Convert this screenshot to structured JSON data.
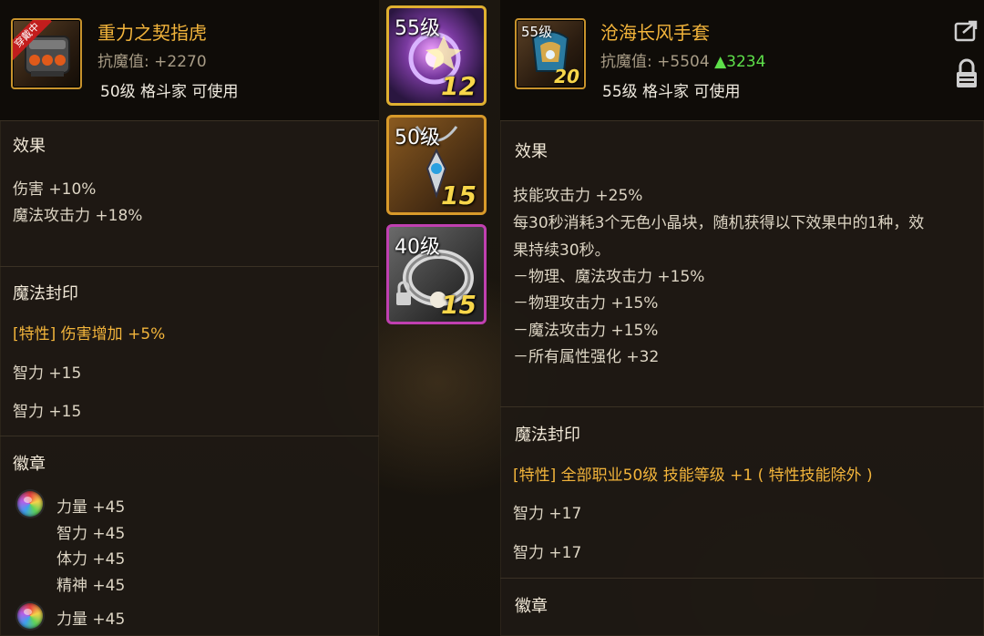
{
  "left_item": {
    "badge": "穿戴中",
    "name": "重力之契指虎",
    "resist_label": "抗魔值: ",
    "resist_value": "+2270",
    "requirement": "50级 格斗家 可使用",
    "effects_title": "效果",
    "effects": [
      "伤害 +10%",
      "魔法攻击力 +18%"
    ],
    "seal_title": "魔法封印",
    "seal_trait": "[特性] 伤害增加 +5%",
    "seal_lines": [
      "智力 +15",
      "智力 +15"
    ],
    "emblem_title": "徽章",
    "emblem_group1": [
      "力量 +45",
      "智力 +45",
      "体力 +45",
      "精神 +45"
    ],
    "emblem_group2": [
      "力量 +45"
    ]
  },
  "compare_thumbs": [
    {
      "level": "55级",
      "count": "12",
      "border": "#e0b030"
    },
    {
      "level": "50级",
      "count": "15",
      "border": "#d89a2a"
    },
    {
      "level": "40级",
      "count": "15",
      "border": "#c040b0"
    }
  ],
  "right_item": {
    "level_badge": "55级",
    "count_badge": "20",
    "name": "沧海长风手套",
    "resist_label": "抗魔值: ",
    "resist_value": "+5504",
    "resist_diff": "▲3234",
    "requirement": "55级 格斗家 可使用",
    "effects_title": "效果",
    "effects": [
      "技能攻击力 +25%",
      "每30秒消耗3个无色小晶块，随机获得以下效果中的1种，效",
      "果持续30秒。",
      "－物理、魔法攻击力 +15%",
      "－物理攻击力 +15%",
      "－魔法攻击力 +15%",
      "－所有属性强化 +32"
    ],
    "seal_title": "魔法封印",
    "seal_trait": "[特性] 全部职业50级 技能等级 +1 ( 特性技能除外 )",
    "seal_lines": [
      "智力 +17",
      "智力 +17"
    ],
    "emblem_title": "徽章"
  },
  "colors": {
    "item_name": "#f2b43b",
    "resist_up": "#5ee04a",
    "trait": "#f2b43b"
  },
  "icons": [
    "share-icon",
    "lock-icon",
    "rainbow-orb-icon",
    "lock-small-icon"
  ]
}
